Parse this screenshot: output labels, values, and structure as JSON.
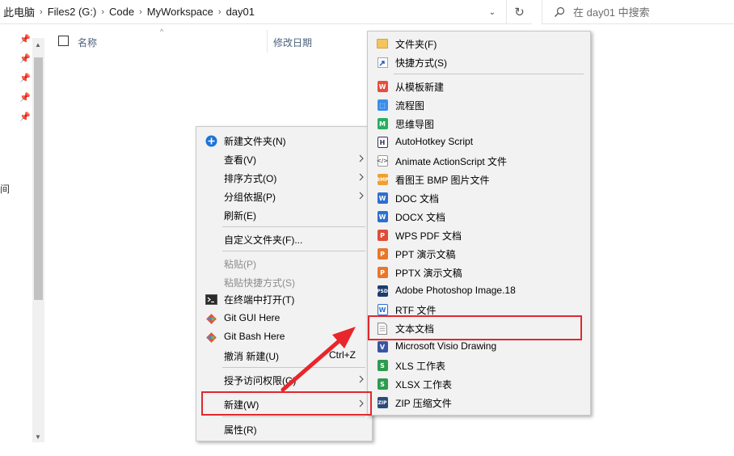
{
  "address": {
    "crumbs": [
      "此电脑",
      "Files2 (G:)",
      "Code",
      "MyWorkspace",
      "day01"
    ],
    "dropdown_glyph": "⌄",
    "refresh_glyph": "↻"
  },
  "search": {
    "placeholder": "在 day01 中搜索"
  },
  "nav": {
    "partial_text": "间",
    "pin_icon": "pin-icon"
  },
  "columns": {
    "name": "名称",
    "date": "修改日期"
  },
  "context_menu": {
    "items": [
      {
        "label": "新建文件夹(N)",
        "icon": "new-folder-icon"
      },
      {
        "label": "查看(V)",
        "submenu": true
      },
      {
        "label": "排序方式(O)",
        "submenu": true
      },
      {
        "label": "分组依据(P)",
        "submenu": true
      },
      {
        "label": "刷新(E)"
      },
      {
        "label": "自定义文件夹(F)..."
      },
      {
        "label": "粘贴(P)",
        "disabled": true
      },
      {
        "label": "粘贴快捷方式(S)",
        "disabled": true
      },
      {
        "label": "在终端中打开(T)",
        "icon": "terminal-icon"
      },
      {
        "label": "Git GUI Here",
        "icon": "git-icon"
      },
      {
        "label": "Git Bash Here",
        "icon": "git-icon"
      },
      {
        "label": "撤消 新建(U)",
        "shortcut": "Ctrl+Z"
      },
      {
        "label": "授予访问权限(G)",
        "submenu": true
      },
      {
        "label": "新建(W)",
        "submenu": true,
        "highlighted": true
      },
      {
        "label": "属性(R)"
      }
    ]
  },
  "new_submenu": {
    "items": [
      {
        "label": "文件夹(F)",
        "icon": "folder-icon"
      },
      {
        "label": "快捷方式(S)",
        "icon": "shortcut-icon"
      },
      {
        "label": "从模板新建",
        "icon": "wps-template-icon"
      },
      {
        "label": "流程图",
        "icon": "flowchart-icon"
      },
      {
        "label": "思维导图",
        "icon": "mindmap-icon"
      },
      {
        "label": "AutoHotkey Script",
        "icon": "autohotkey-icon"
      },
      {
        "label": "Animate ActionScript 文件",
        "icon": "actionscript-icon"
      },
      {
        "label": "看图王 BMP 图片文件",
        "icon": "bmp-icon"
      },
      {
        "label": "DOC 文档",
        "icon": "doc-icon"
      },
      {
        "label": "DOCX 文档",
        "icon": "docx-icon"
      },
      {
        "label": "WPS PDF 文档",
        "icon": "pdf-icon"
      },
      {
        "label": "PPT 演示文稿",
        "icon": "ppt-icon"
      },
      {
        "label": "PPTX 演示文稿",
        "icon": "pptx-icon"
      },
      {
        "label": "Adobe Photoshop Image.18",
        "icon": "psd-icon"
      },
      {
        "label": "RTF 文件",
        "icon": "rtf-icon"
      },
      {
        "label": "文本文档",
        "icon": "text-document-icon",
        "highlighted": true
      },
      {
        "label": "Microsoft Visio Drawing",
        "icon": "visio-icon"
      },
      {
        "label": "XLS 工作表",
        "icon": "xls-icon"
      },
      {
        "label": "XLSX 工作表",
        "icon": "xlsx-icon"
      },
      {
        "label": "ZIP 压缩文件",
        "icon": "zip-icon"
      }
    ]
  },
  "colors": {
    "highlight_border": "#e0282f",
    "menu_background": "#f2f2f2",
    "disabled_text": "#8d8d8d",
    "column_header_text": "#4c607a"
  }
}
